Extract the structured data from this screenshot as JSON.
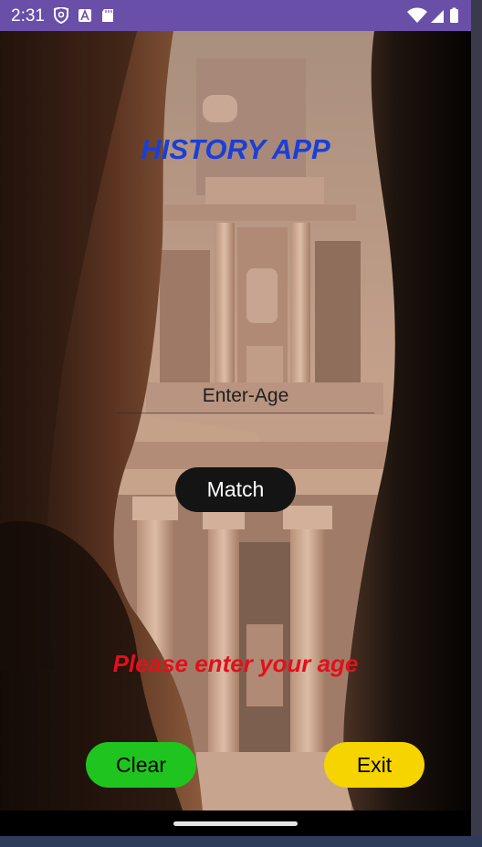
{
  "status_bar": {
    "time": "2:31",
    "left_icons": [
      "shield-icon",
      "app-a-icon",
      "sd-card-icon"
    ],
    "right_icons": [
      "wifi-icon",
      "signal-icon",
      "battery-icon"
    ],
    "color": "#6a4fa8"
  },
  "app": {
    "title": "HISTORY APP",
    "age_input": {
      "value": "",
      "placeholder": "Enter-Age"
    },
    "match_label": "Match",
    "message": "Please enter your age",
    "clear_label": "Clear",
    "exit_label": "Exit"
  },
  "colors": {
    "title": "#1a3fd6",
    "message": "#e3101b",
    "match_button": "#141414",
    "clear_button": "#1fc41f",
    "exit_button": "#f5d400"
  }
}
